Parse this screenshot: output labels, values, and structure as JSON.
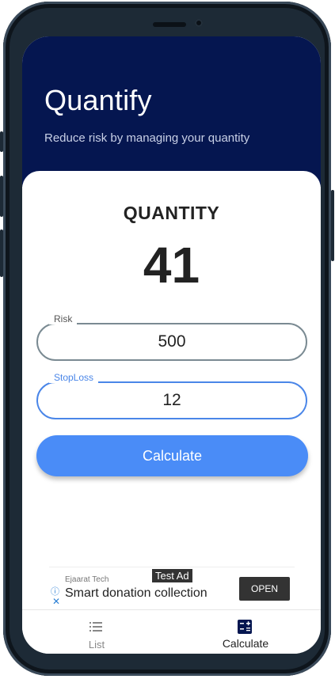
{
  "app": {
    "title": "Quantify",
    "subtitle": "Reduce risk by managing your quantity"
  },
  "result": {
    "label": "QUANTITY",
    "value": "41"
  },
  "form": {
    "risk": {
      "label": "Risk",
      "value": "500"
    },
    "stoploss": {
      "label": "StopLoss",
      "value": "12"
    },
    "calculate_label": "Calculate"
  },
  "ad": {
    "badge": "Test Ad",
    "source": "Ejaarat Tech",
    "headline": "Smart donation collection",
    "open_label": "OPEN",
    "info_icon": "info-icon",
    "close_icon": "close-icon"
  },
  "bottom_nav": {
    "items": [
      {
        "label": "List",
        "icon": "list-icon",
        "active": false
      },
      {
        "label": "Calculate",
        "icon": "calculator-icon",
        "active": true
      }
    ]
  },
  "colors": {
    "header_bg": "#051650",
    "accent": "#4a8cf7",
    "focus_outline": "#4a86e8"
  }
}
